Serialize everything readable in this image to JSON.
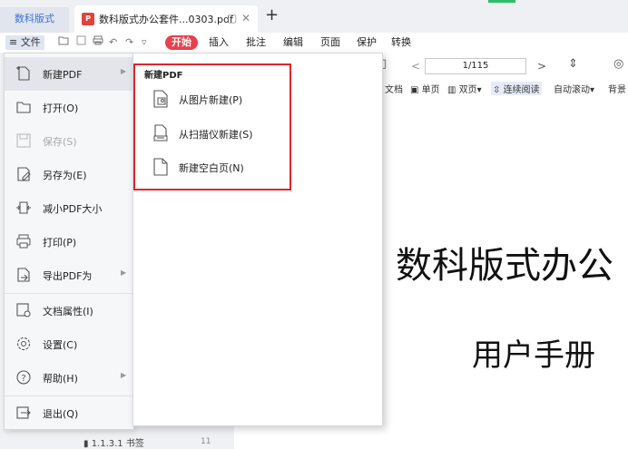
{
  "tabs": {
    "home_label": "数科版式",
    "doc_title": "数科版式办公套件...0303.pdf",
    "pdf_badge": "P",
    "new_tab": "+",
    "close": "✕",
    "pin": "▢"
  },
  "menubar": {
    "file_label": "≡ 文件",
    "menu_tabs": [
      "开始",
      "插入",
      "批注",
      "编辑",
      "页面",
      "保护",
      "转换"
    ],
    "active_tab": "开始"
  },
  "toolbar": {
    "page_indicator": "1/115",
    "prev": "<",
    "next": ">",
    "doc_label": "文档",
    "single_page": "单页",
    "double_page": "双页",
    "continuous": "连续阅读",
    "auto_scroll": "自动滚动",
    "background": "背景"
  },
  "file_menu": {
    "items": [
      {
        "label": "新建PDF",
        "icon": "new-pdf-icon",
        "submenu": true,
        "disabled": false
      },
      {
        "label": "打开(O)",
        "icon": "folder-icon",
        "submenu": false,
        "disabled": false
      },
      {
        "label": "保存(S)",
        "icon": "save-icon",
        "submenu": false,
        "disabled": true
      },
      {
        "label": "另存为(E)",
        "icon": "save-as-icon",
        "submenu": false,
        "disabled": false
      },
      {
        "label": "减小PDF大小",
        "icon": "compress-icon",
        "submenu": false,
        "disabled": false
      },
      {
        "label": "打印(P)",
        "icon": "printer-icon",
        "submenu": false,
        "disabled": false
      },
      {
        "label": "导出PDF为",
        "icon": "export-icon",
        "submenu": true,
        "disabled": false
      },
      {
        "label": "文档属性(I)",
        "icon": "properties-icon",
        "submenu": false,
        "disabled": false
      },
      {
        "label": "设置(C)",
        "icon": "gear-icon",
        "submenu": false,
        "disabled": false
      },
      {
        "label": "帮助(H)",
        "icon": "help-icon",
        "submenu": true,
        "disabled": false
      },
      {
        "label": "退出(Q)",
        "icon": "exit-icon",
        "submenu": false,
        "disabled": false
      }
    ]
  },
  "submenu": {
    "heading": "新建PDF",
    "items": [
      {
        "label": "从图片新建(P)",
        "icon": "image-file-icon"
      },
      {
        "label": "从扫描仪新建(S)",
        "icon": "scanner-icon"
      },
      {
        "label": "新建空白页(N)",
        "icon": "blank-page-icon"
      }
    ]
  },
  "outline": {
    "item": "1.1.3.1 书签",
    "page": "11"
  },
  "document": {
    "title": "数科版式办公",
    "subtitle": "用户手册"
  },
  "colors": {
    "accent_red": "#e8404e",
    "highlight_red": "#e0242e",
    "tab_blue": "#3b6fd6"
  }
}
